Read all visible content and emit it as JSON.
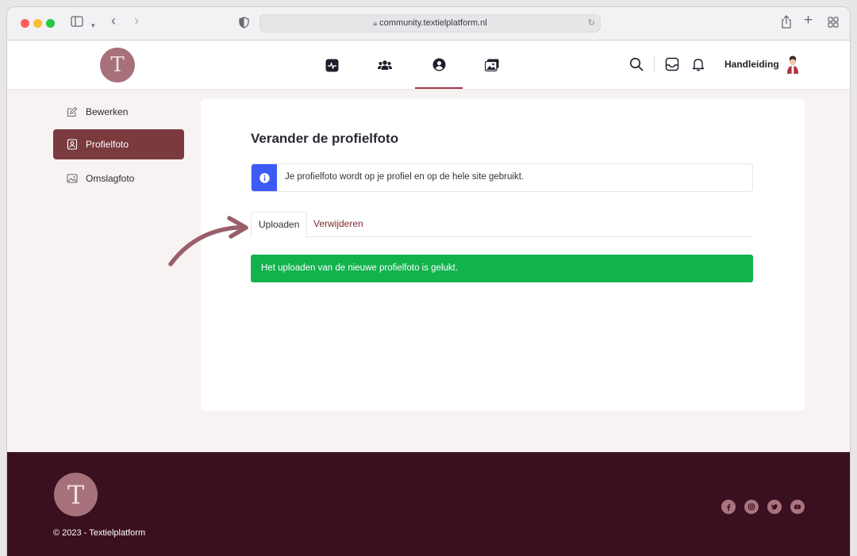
{
  "browser": {
    "url": "community.textielplatform.nl"
  },
  "header": {
    "logo_letter": "T",
    "manual_label": "Handleiding",
    "nav": [
      {
        "icon": "activity-icon"
      },
      {
        "icon": "groups-icon"
      },
      {
        "icon": "profile-icon",
        "active": true
      },
      {
        "icon": "media-icon"
      }
    ]
  },
  "sidebar": {
    "items": [
      {
        "label": "Bewerken",
        "icon": "edit-icon"
      },
      {
        "label": "Profielfoto",
        "icon": "profile-photo-icon",
        "active": true
      },
      {
        "label": "Omslagfoto",
        "icon": "cover-photo-icon"
      }
    ]
  },
  "main": {
    "title": "Verander de profielfoto",
    "info_text": "Je profielfoto wordt op je profiel en op de hele site gebruikt.",
    "tabs": [
      {
        "label": "Uploaden",
        "active": true
      },
      {
        "label": "Verwijderen"
      }
    ],
    "success_text": "Het uploaden van de nieuwe profielfoto is gelukt."
  },
  "footer": {
    "logo_letter": "T",
    "copyright": "© 2023 - Textielplatform",
    "social": [
      "facebook-icon",
      "instagram-icon",
      "twitter-icon",
      "youtube-icon"
    ]
  },
  "colors": {
    "accent": "#7a3a3e",
    "footer_bg": "#3a1020",
    "success": "#12b24d",
    "info": "#3c5bf5",
    "logo_bg": "#a7717b"
  }
}
